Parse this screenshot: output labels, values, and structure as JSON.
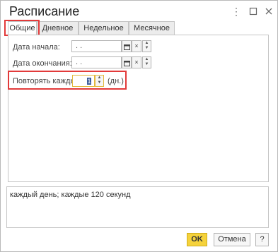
{
  "window": {
    "title": "Расписание",
    "more_icon": "more-vert-icon",
    "maximize_icon": "maximize-icon",
    "close_icon": "close-icon"
  },
  "tabs": [
    {
      "label": "Общие",
      "active": true
    },
    {
      "label": "Дневное",
      "active": false
    },
    {
      "label": "Недельное",
      "active": false
    },
    {
      "label": "Месячное",
      "active": false
    }
  ],
  "fields": {
    "start_date_label": "Дата начала:",
    "start_date_value": " .  .",
    "end_date_label": "Дата окончания:",
    "end_date_value": " .  .",
    "repeat_label": "Повторять каждые:",
    "repeat_value": "1",
    "repeat_unit": "(дн.)"
  },
  "summary": {
    "text": "каждый день; каждые 120 секунд"
  },
  "buttons": {
    "ok": "OK",
    "cancel": "Отмена",
    "help": "?"
  },
  "colors": {
    "highlight_red": "#e23a3a",
    "ok_yellow": "#f5d23b",
    "focus_border": "#e3b93d"
  }
}
